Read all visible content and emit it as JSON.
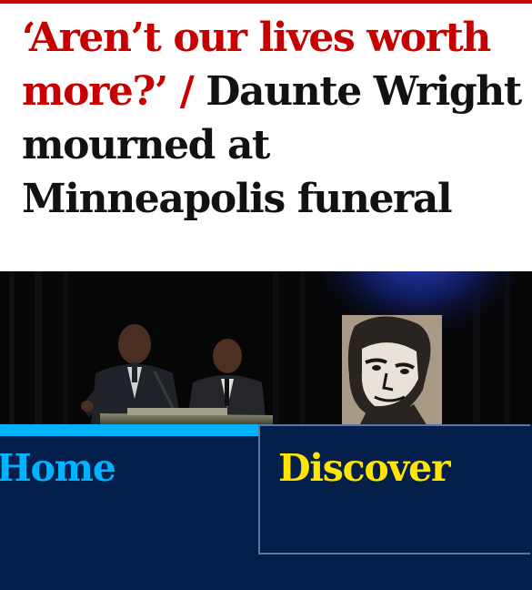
{
  "article": {
    "kicker": "‘Aren’t our lives worth more?’ /",
    "headline": "Daunte Wright mourned at Minneapolis funeral"
  },
  "nav": {
    "tabs": [
      {
        "label": "Home",
        "active": true
      },
      {
        "label": "Discover",
        "active": false
      }
    ]
  },
  "colors": {
    "kicker": "#c70000",
    "nav_background": "#041f4a",
    "home_active": "#00b2ff",
    "discover": "#ffe500"
  }
}
